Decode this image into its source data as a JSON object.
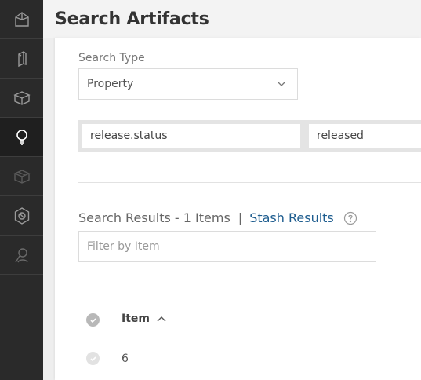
{
  "page": {
    "title": "Search Artifacts"
  },
  "sidebar": {
    "items": [
      {
        "icon": "home-icon"
      },
      {
        "icon": "artifacts-icon"
      },
      {
        "icon": "builds-icon"
      },
      {
        "icon": "search-icon",
        "active": true
      },
      {
        "icon": "packages-icon"
      },
      {
        "icon": "settings-icon"
      },
      {
        "icon": "user-search-icon"
      }
    ]
  },
  "search": {
    "type_label": "Search Type",
    "type_value": "Property",
    "property_key": "release.status",
    "property_value": "released"
  },
  "results": {
    "count_label": "Search Results - 1 Items",
    "separator": "|",
    "stash_label": "Stash Results",
    "filter_placeholder": "Filter by Item",
    "column_item": "Item",
    "rows": [
      {
        "item": "6"
      }
    ]
  },
  "colors": {
    "sidebar_bg": "#2a2a2a",
    "link": "#1e5d8f",
    "active_icon": "#ffffff",
    "inactive_icon": "#8a8a8a"
  }
}
